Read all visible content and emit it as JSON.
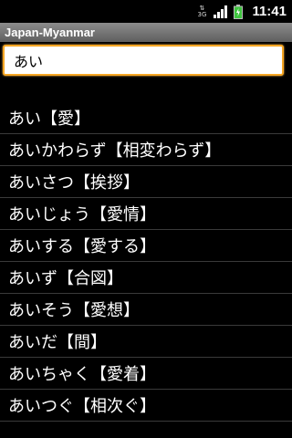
{
  "status_bar": {
    "network": "3G",
    "time": "11:41"
  },
  "app": {
    "title": "Japan-Myanmar"
  },
  "search": {
    "value": "あい"
  },
  "results": [
    "あい【愛】",
    "あいかわらず【相変わらず】",
    "あいさつ【挨拶】",
    "あいじょう【愛情】",
    "あいする【愛する】",
    "あいず【合図】",
    "あいそう【愛想】",
    "あいだ【間】",
    "あいちゃく【愛着】",
    "あいつぐ【相次ぐ】"
  ],
  "colors": {
    "background": "#000000",
    "title_bar": "#7a7a7a",
    "focus_border": "#f5a623",
    "battery": "#3ec43e"
  }
}
